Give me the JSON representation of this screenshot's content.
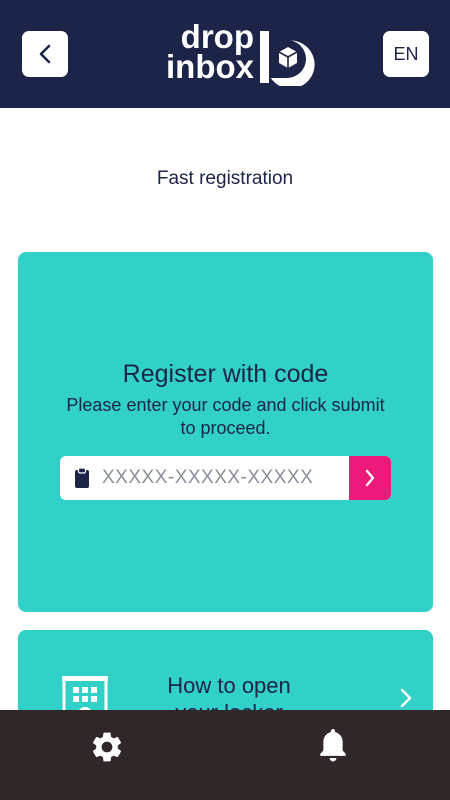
{
  "header": {
    "logo_line1": "drop",
    "logo_line2": "inbox",
    "language": "EN"
  },
  "page": {
    "subtitle": "Fast registration"
  },
  "register_card": {
    "title": "Register with code",
    "description": "Please enter your code and click submit to proceed.",
    "code_input": {
      "value": "",
      "placeholder": "XXXXX-XXXXX-XXXXX"
    }
  },
  "locker_card": {
    "title": "How to open your locker"
  },
  "icons": {
    "back": "chevron-left-icon",
    "clipboard": "clipboard-icon",
    "submit": "chevron-right-icon",
    "locker": "locker-building-icon",
    "settings": "gear-icon",
    "notifications": "bell-icon"
  },
  "colors": {
    "header_bg": "#1c2447",
    "card_bg": "#31d1c8",
    "accent": "#ec1a7a",
    "bottom_bar_bg": "#302728",
    "text": "#1c2447"
  }
}
